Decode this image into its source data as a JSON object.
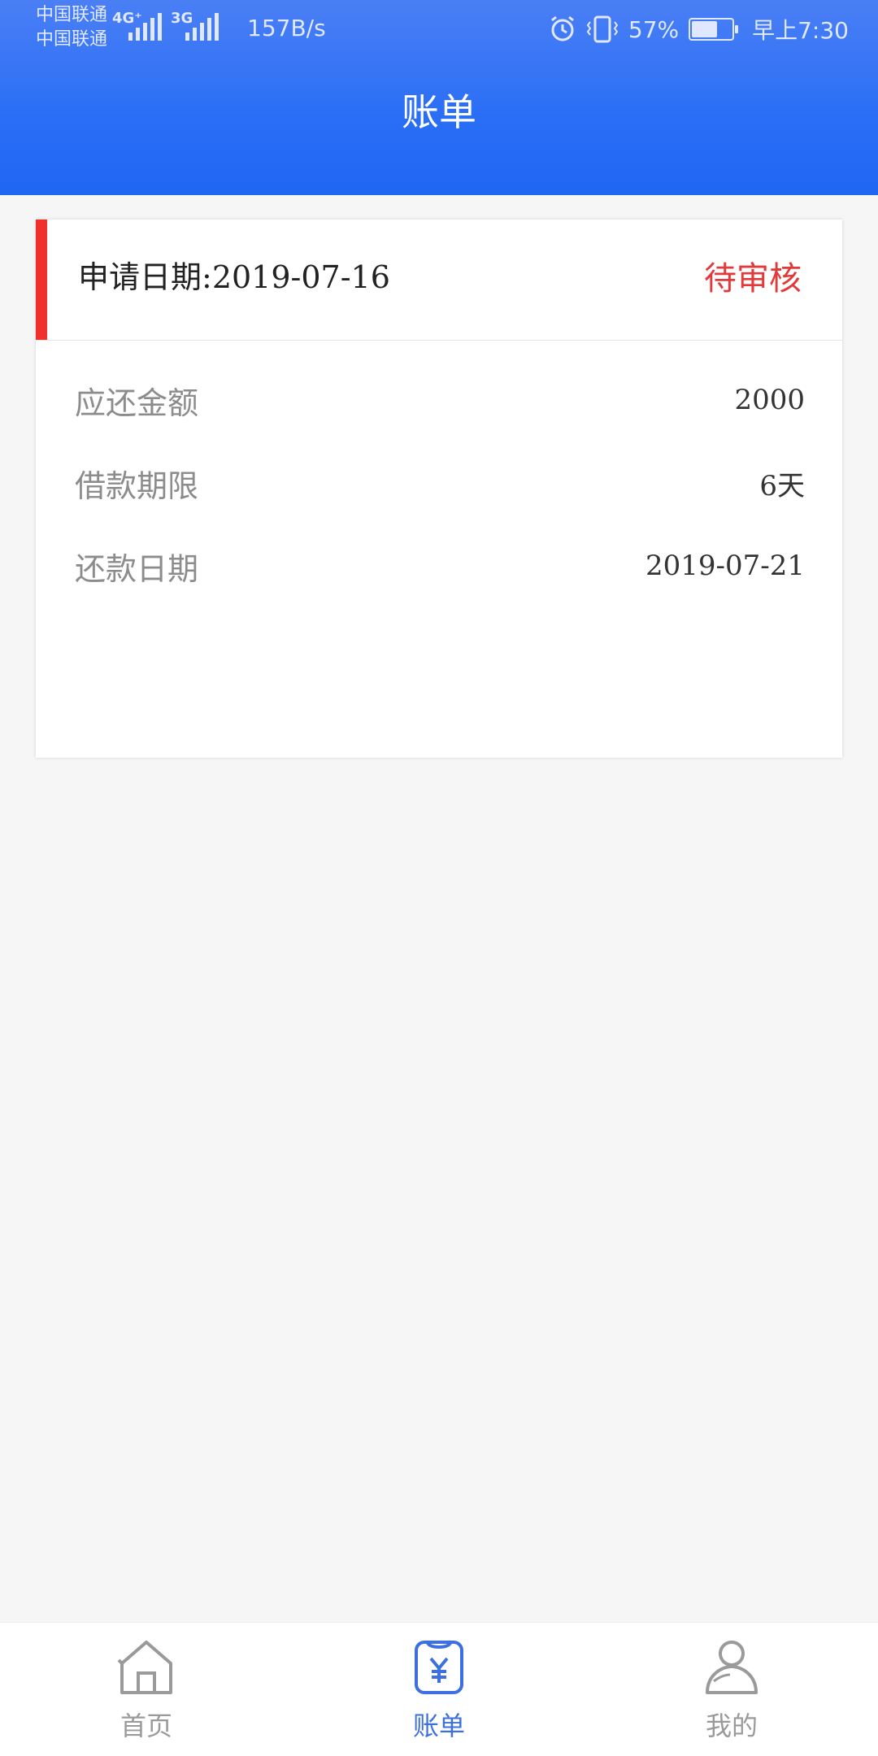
{
  "status_bar": {
    "carrier_1": "中国联通",
    "carrier_2": "中国联通",
    "network_1": "4G⁺",
    "network_2": "3G",
    "speed": "157B/s",
    "battery": "57%",
    "time": "早上7:30"
  },
  "header": {
    "title": "账单"
  },
  "bill": {
    "apply_label": "申请日期:",
    "apply_date": "2019-07-16",
    "status": "待审核",
    "rows": [
      {
        "label": "应还金额",
        "value": "2000"
      },
      {
        "label": "借款期限",
        "value": "6天"
      },
      {
        "label": "还款日期",
        "value": "2019-07-21"
      }
    ]
  },
  "tabbar": {
    "tabs": [
      {
        "label": "首页",
        "icon": "home-icon",
        "active": false
      },
      {
        "label": "账单",
        "icon": "bill-icon",
        "active": true
      },
      {
        "label": "我的",
        "icon": "user-icon",
        "active": false
      }
    ]
  },
  "colors": {
    "header": "#2a6ef5",
    "accent": "#3e6fe0",
    "status_red": "#e23a3a",
    "bar_red": "#f0302c"
  }
}
